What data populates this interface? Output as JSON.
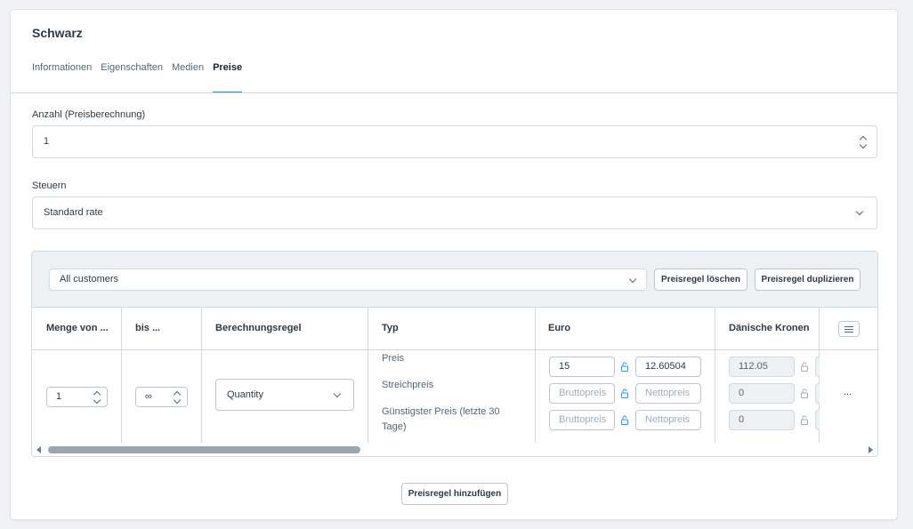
{
  "card": {
    "title": "Schwarz"
  },
  "tabs": [
    {
      "label": "Informationen",
      "active": false
    },
    {
      "label": "Eigenschaften",
      "active": false
    },
    {
      "label": "Medien",
      "active": false
    },
    {
      "label": "Preise",
      "active": true
    }
  ],
  "quantity_field": {
    "label": "Anzahl (Preisberechnung)",
    "value": "1"
  },
  "tax_field": {
    "label": "Steuern",
    "value": "Standard rate"
  },
  "price_rule": {
    "rule_select": "All customers",
    "delete_label": "Preisregel löschen",
    "duplicate_label": "Preisregel duplizieren",
    "columns": {
      "quantity_from": "Menge von ...",
      "quantity_to": "bis ...",
      "calc_rule": "Berechnungsregel",
      "type": "Typ",
      "euro": "Euro",
      "dkk": "Dänische Kronen"
    },
    "row": {
      "quantity_from": "1",
      "quantity_to": "∞",
      "calc_rule": "Quantity",
      "type_labels": {
        "price": "Preis",
        "list_price": "Streichpreis",
        "lowest_price": "Günstigster Preis (letzte 30 Tage)"
      },
      "euro": {
        "price_gross": "15",
        "price_net": "12.60504",
        "list_gross_placeholder": "Bruttopreis",
        "list_net_placeholder": "Nettopreis",
        "lowest_gross_placeholder": "Bruttopreis",
        "lowest_net_placeholder": "Nettopreis"
      },
      "dkk": {
        "price_gross": "112.05",
        "list_gross": "0",
        "lowest_gross": "0"
      },
      "actions_label": "..."
    }
  },
  "add_rule_label": "Preisregel hinzufügen",
  "colors": {
    "accent": "#189eff",
    "text": "#2d3a48",
    "border": "#d1d9e0",
    "lock_blue": "#189eff",
    "lock_grey": "#a0adb8"
  },
  "icons": [
    "stepper-arrows-icon",
    "chevron-down-icon",
    "lock-icon",
    "column-settings-icon",
    "more-actions-icon",
    "scroll-left-icon",
    "scroll-right-icon"
  ]
}
